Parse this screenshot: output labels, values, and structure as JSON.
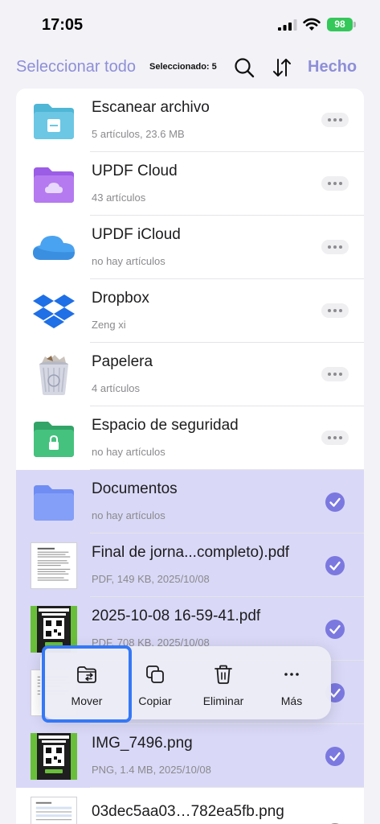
{
  "status_bar": {
    "time": "17:05",
    "battery": "98"
  },
  "nav": {
    "select_all": "Seleccionar todo",
    "selected_count": "Seleccionado: 5",
    "done": "Hecho",
    "icons": [
      "search-icon",
      "sort-icon"
    ]
  },
  "files": [
    {
      "title": "Escanear archivo",
      "subtitle": "5 artículos, 23.6 MB",
      "icon": "teal-scan-folder-icon",
      "selected": false,
      "accessory": "more"
    },
    {
      "title": "UPDF Cloud",
      "subtitle": "43 artículos",
      "icon": "purple-cloud-folder-icon",
      "selected": false,
      "accessory": "more"
    },
    {
      "title": "UPDF iCloud",
      "subtitle": "no hay artículos",
      "icon": "icloud-icon",
      "selected": false,
      "accessory": "more"
    },
    {
      "title": "Dropbox",
      "subtitle": "Zeng xi",
      "icon": "dropbox-icon",
      "selected": false,
      "accessory": "more"
    },
    {
      "title": "Papelera",
      "subtitle": "4 artículos",
      "icon": "trash-bin-icon",
      "selected": false,
      "accessory": "more"
    },
    {
      "title": "Espacio de seguridad",
      "subtitle": "no hay artículos",
      "icon": "green-lock-folder-icon",
      "selected": false,
      "accessory": "more"
    },
    {
      "title": "Documentos",
      "subtitle": "no hay artículos",
      "icon": "blue-folder-icon",
      "selected": true,
      "accessory": "check"
    },
    {
      "title": "Final de jorna...completo).pdf",
      "subtitle": "PDF, 149 KB, 2025/10/08",
      "icon": "pdf-document-thumbnail",
      "selected": true,
      "accessory": "check"
    },
    {
      "title": "2025-10-08 16-59-41.pdf",
      "subtitle": "PDF, 708 KB, 2025/10/08",
      "icon": "garden-poster-thumbnail",
      "selected": true,
      "accessory": "check"
    },
    {
      "title": "",
      "subtitle": "",
      "icon": "pdf-document-thumbnail",
      "selected": true,
      "accessory": "check"
    },
    {
      "title": "IMG_7496.png",
      "subtitle": "PNG, 1.4 MB, 2025/10/08",
      "icon": "garden-poster-thumbnail",
      "selected": true,
      "accessory": "check"
    },
    {
      "title": "03dec5aa03…782ea5fb.png",
      "subtitle": "",
      "icon": "screenshot-thumbnail",
      "selected": false,
      "accessory": "radio"
    }
  ],
  "actions": {
    "move": "Mover",
    "copy": "Copiar",
    "delete": "Eliminar",
    "more": "Más"
  },
  "colors": {
    "accent": "#7b78e0",
    "nav_text": "#8e8ed8",
    "selected_row": "#d9d8f6",
    "highlight": "#3478f6"
  }
}
